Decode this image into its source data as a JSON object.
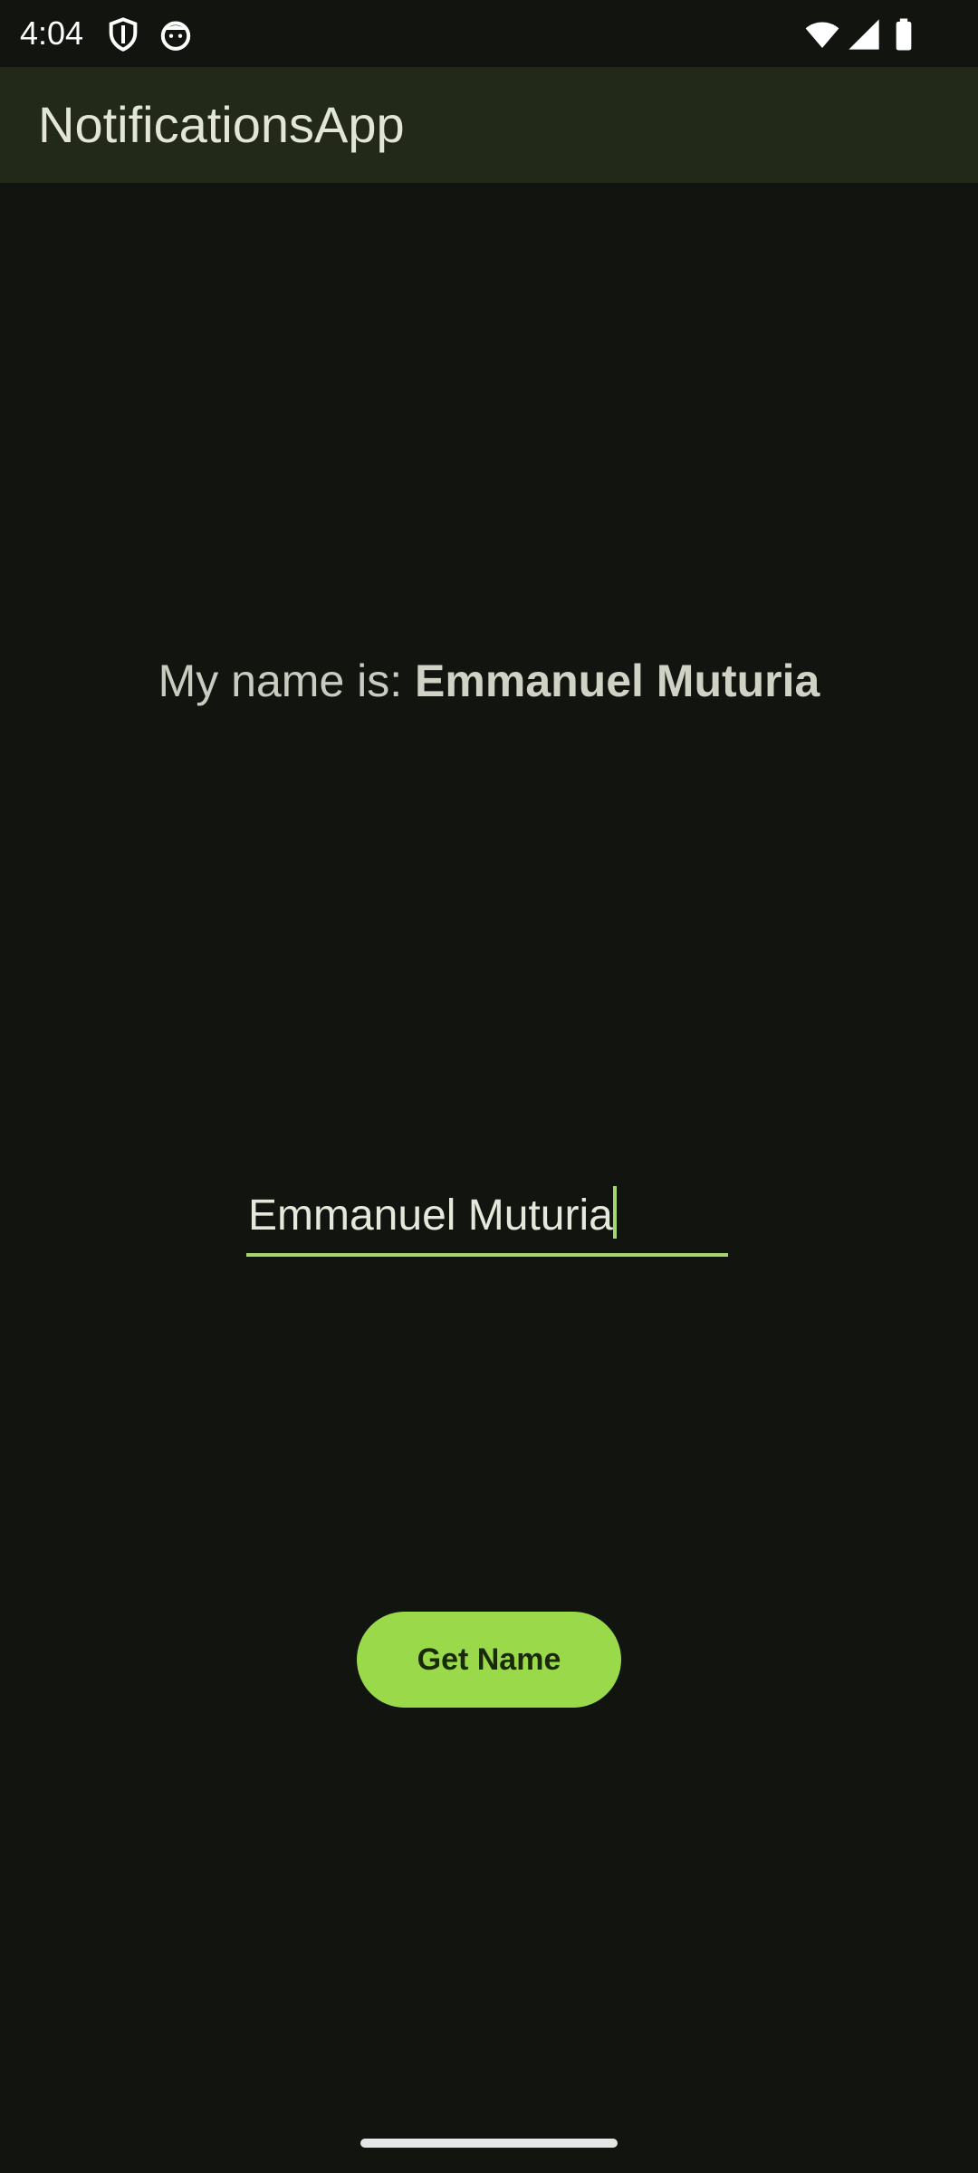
{
  "status_bar": {
    "time": "4:04",
    "icons": [
      "shield-icon",
      "face-icon",
      "wifi-icon",
      "signal-icon",
      "battery-icon"
    ]
  },
  "app_bar": {
    "title": "NotificationsApp"
  },
  "main": {
    "name_prefix": "My name is: ",
    "name_value": "Emmanuel Muturia",
    "input_value": "Emmanuel Muturia",
    "button_label": "Get Name"
  },
  "colors": {
    "background": "#121410",
    "app_bar": "#222918",
    "accent": "#a6d672",
    "button": "#9ad94a"
  }
}
